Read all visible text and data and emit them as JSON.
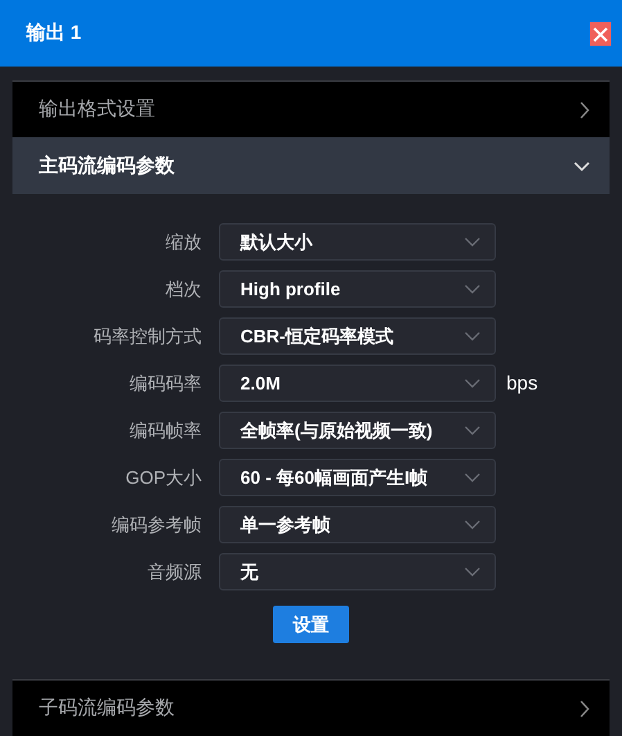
{
  "window": {
    "title": "输出 1"
  },
  "sections": [
    {
      "title": "输出格式设置",
      "expanded": false
    },
    {
      "title": "主码流编码参数",
      "expanded": true,
      "fields": [
        {
          "label": "缩放",
          "value": "默认大小"
        },
        {
          "label": "档次",
          "value": "High profile"
        },
        {
          "label": "码率控制方式",
          "value": "CBR-恒定码率模式"
        },
        {
          "label": "编码码率",
          "value": "2.0M",
          "unit": "bps"
        },
        {
          "label": "编码帧率",
          "value": "全帧率(与原始视频一致)"
        },
        {
          "label": "GOP大小",
          "value": "60 - 每60幅画面产生I帧"
        },
        {
          "label": "编码参考帧",
          "value": "单一参考帧"
        },
        {
          "label": "音频源",
          "value": "无"
        }
      ],
      "button": "设置"
    },
    {
      "title": "子码流编码参数",
      "expanded": false
    }
  ]
}
